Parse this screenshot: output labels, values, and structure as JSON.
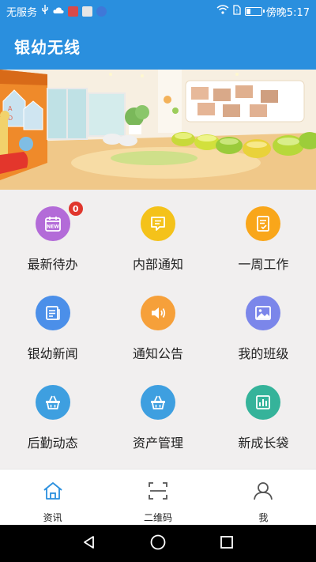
{
  "status_bar": {
    "carrier": "无服务",
    "time_text": "傍晚5:17",
    "battery_level": 0.3
  },
  "app": {
    "title": "银幼无线"
  },
  "banner": {
    "image_name": "kindergarten-classroom-banner"
  },
  "menu": {
    "items": [
      {
        "label": "最新待办",
        "icon": "calendar-new-icon",
        "color": "#b36bd8",
        "badge": "0"
      },
      {
        "label": "内部通知",
        "icon": "notice-card-icon",
        "color": "#f4c21a"
      },
      {
        "label": "一周工作",
        "icon": "checklist-icon",
        "color": "#f9a61a"
      },
      {
        "label": "银幼新闻",
        "icon": "newspaper-icon",
        "color": "#4b8fe9"
      },
      {
        "label": "通知公告",
        "icon": "speaker-icon",
        "color": "#f6a03a"
      },
      {
        "label": "我的班级",
        "icon": "picture-icon",
        "color": "#7b86ea"
      },
      {
        "label": "后勤动态",
        "icon": "basket-icon",
        "color": "#3e9fe0"
      },
      {
        "label": "资产管理",
        "icon": "basket-icon",
        "color": "#3e9fe0"
      },
      {
        "label": "新成长袋",
        "icon": "bar-chart-icon",
        "color": "#35b39a"
      }
    ]
  },
  "tabbar": {
    "tabs": [
      {
        "label": "资讯",
        "icon": "home-icon",
        "active": true
      },
      {
        "label": "二维码",
        "icon": "scan-icon",
        "active": false
      },
      {
        "label": "我",
        "icon": "user-icon",
        "active": false
      }
    ],
    "active_color": "#2a8fde"
  },
  "colors": {
    "primary": "#2a8fde",
    "badge": "#e0362c"
  }
}
